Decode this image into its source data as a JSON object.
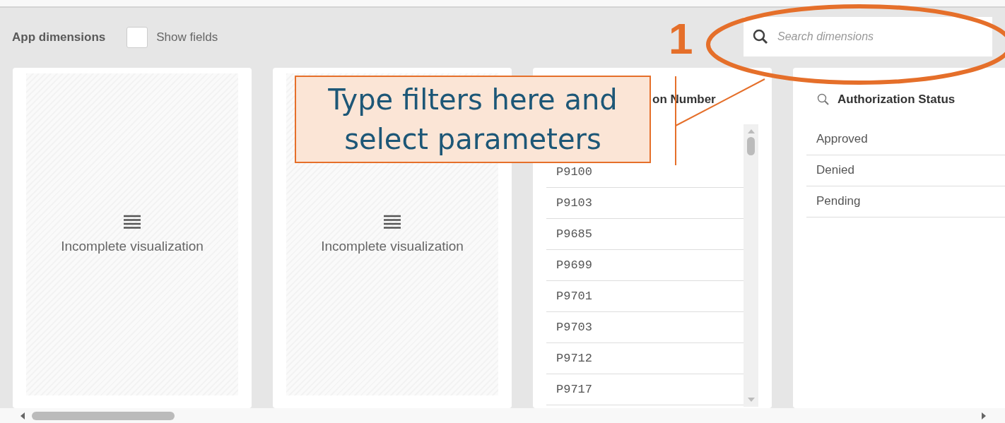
{
  "header": {
    "title": "App dimensions",
    "show_fields": {
      "label": "Show fields",
      "checked": false
    },
    "search": {
      "placeholder": "Search dimensions"
    }
  },
  "cards": [
    {
      "kind": "incomplete",
      "message": "Incomplete visualization"
    },
    {
      "kind": "incomplete",
      "message": "Incomplete visualization"
    },
    {
      "kind": "list",
      "title": "on Number",
      "search_icon": false,
      "mono": true,
      "items": [
        "P9100",
        "P9103",
        "P9685",
        "P9699",
        "P9701",
        "P9703",
        "P9712",
        "P9717"
      ]
    },
    {
      "kind": "list",
      "title": "Authorization Status",
      "search_icon": true,
      "mono": false,
      "items": [
        "Approved",
        "Denied",
        "Pending"
      ]
    }
  ],
  "annotation": {
    "number": "1",
    "text": "Type filters here and select parameters"
  }
}
